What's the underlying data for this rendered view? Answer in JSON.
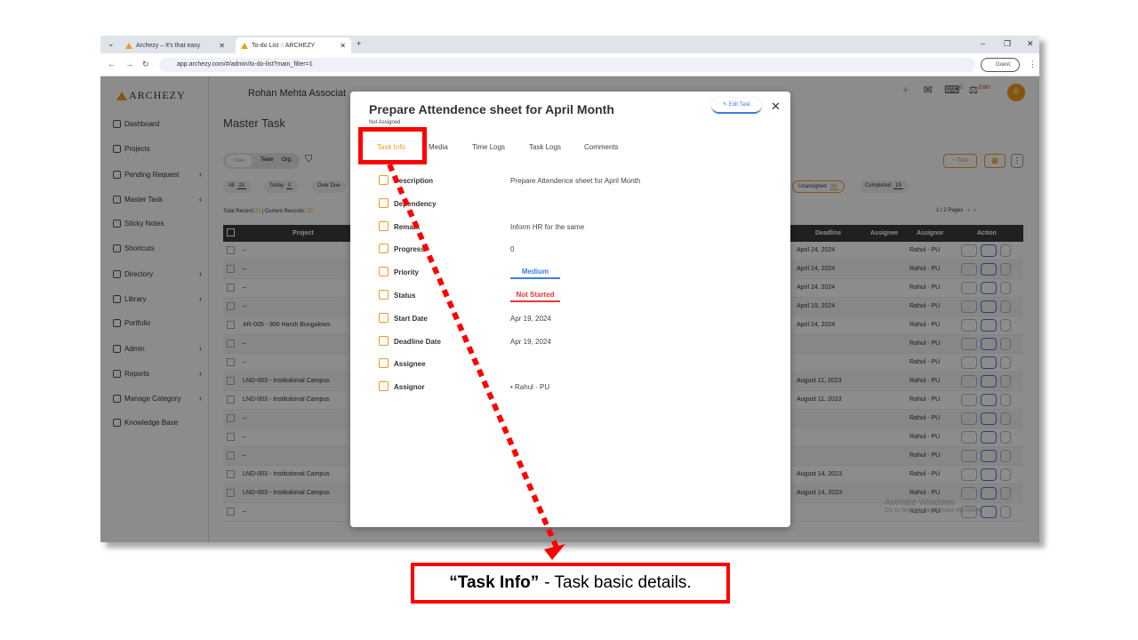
{
  "browser": {
    "tabs": [
      {
        "title": "Archezy – It's that easy",
        "active": false
      },
      {
        "title": "To-do List :: ARCHEZY",
        "active": true
      }
    ],
    "new_tab": "+",
    "url": "app.archezy.com/#/admin/to-do-list?main_filter=1",
    "profile": "Guest",
    "controls": {
      "minimize": "–",
      "restore": "❐",
      "close": "✕"
    }
  },
  "app": {
    "brand": "ARCHEZY",
    "company": "Rohan Mehta Associat",
    "page_title": "Master Task",
    "notif_count": "0",
    "badge_count": "2080",
    "avatar_initial": "R",
    "sidebar": [
      {
        "label": "Dashboard",
        "icon": "home-icon",
        "chevron": ""
      },
      {
        "label": "Projects",
        "icon": "building-icon",
        "chevron": ""
      },
      {
        "label": "Pending Request",
        "icon": "clipboard-icon",
        "chevron": "‹"
      },
      {
        "label": "Master Task",
        "icon": "list-icon",
        "chevron": "‹"
      },
      {
        "label": "Sticky Notes",
        "icon": "note-icon",
        "chevron": ""
      },
      {
        "label": "Shortcuts",
        "icon": "shortcut-icon",
        "chevron": ""
      },
      {
        "label": "Directory",
        "icon": "book-icon",
        "chevron": "‹"
      },
      {
        "label": "Library",
        "icon": "library-icon",
        "chevron": "‹"
      },
      {
        "label": "Portfolio",
        "icon": "folder-icon",
        "chevron": ""
      },
      {
        "label": "Admin",
        "icon": "shield-icon",
        "chevron": "‹"
      },
      {
        "label": "Reports",
        "icon": "report-icon",
        "chevron": "‹"
      },
      {
        "label": "Manage Category",
        "icon": "category-icon",
        "chevron": "‹"
      },
      {
        "label": "Knowledge Base",
        "icon": "bulb-icon",
        "chevron": ""
      }
    ],
    "toggle": {
      "user": "User",
      "team": "Team",
      "org": "Org."
    },
    "filters": [
      {
        "label": "All",
        "count": "21"
      },
      {
        "label": "Today",
        "count": "0"
      },
      {
        "label": "Over Due",
        "count": ""
      }
    ],
    "status_filters": [
      {
        "label": "Unassigned",
        "count": "21"
      },
      {
        "label": "Completed",
        "count": "19"
      }
    ],
    "records_label": "Total Record:",
    "records_total": "23",
    "records_sep": " | Current Records: ",
    "records_current": "20",
    "pagination": "1 / 2 Pages",
    "task_button": "+ Task",
    "columns": {
      "project": "Project",
      "deadline": "Deadline",
      "assignee": "Assignee",
      "assignor": "Assignor",
      "action": "Action"
    },
    "rows": [
      {
        "project": "–",
        "deadline": "April 24, 2024",
        "assignor": "Rahul - PU"
      },
      {
        "project": "–",
        "deadline": "April 24, 2024",
        "assignor": "Rahul - PU"
      },
      {
        "project": "–",
        "deadline": "April 24, 2024",
        "assignor": "Rahul - PU"
      },
      {
        "project": "–",
        "deadline": "April 19, 2024",
        "assignor": "Rahul - PU"
      },
      {
        "project": "AR-005 - 900 Harsh Bungalows",
        "deadline": "April 24, 2024",
        "assignor": "Rahul - PU"
      },
      {
        "project": "–",
        "deadline": "",
        "assignor": "Rahul - PU"
      },
      {
        "project": "–",
        "deadline": "",
        "assignor": "Rahul - PU"
      },
      {
        "project": "LND-003 - Institutional Campus",
        "deadline": "August 11, 2023",
        "assignor": "Rahul - PU"
      },
      {
        "project": "LND-003 - Institutional Campus",
        "deadline": "August 11, 2023",
        "assignor": "Rahul - PU"
      },
      {
        "project": "–",
        "deadline": "",
        "assignor": "Rahul - PU"
      },
      {
        "project": "–",
        "deadline": "",
        "assignor": "Rahul - PU"
      },
      {
        "project": "–",
        "deadline": "",
        "assignor": "Rahul - PU"
      },
      {
        "project": "LND-003 - Institutional Campus",
        "deadline": "August 14, 2023",
        "assignor": "Rahul - PU"
      },
      {
        "project": "LND-003 - Institutional Campus",
        "deadline": "August 14, 2023",
        "assignor": "Rahul - PU"
      },
      {
        "project": "–",
        "deadline": "",
        "assignor": "Rahul - PU"
      }
    ],
    "watermark_title": "Activate Windows",
    "watermark_sub": "Go to Settings to activate Windows."
  },
  "modal": {
    "title": "Prepare Attendence sheet for April Month",
    "subtitle": "Not Assigned",
    "edit_label": "Edit Task",
    "close": "✕",
    "tabs": [
      "Task Info",
      "Media",
      "Time Logs",
      "Task Logs",
      "Comments"
    ],
    "fields": [
      {
        "label": "Description",
        "value": "Prepare Attendence sheet for April Month"
      },
      {
        "label": "Dependency",
        "value": ""
      },
      {
        "label": "Remark",
        "value": "Inform HR for the same"
      },
      {
        "label": "Progress",
        "value": "0"
      },
      {
        "label": "Priority",
        "value": "Medium"
      },
      {
        "label": "Status",
        "value": "Not Started"
      },
      {
        "label": "Start Date",
        "value": "Apr 19, 2024"
      },
      {
        "label": "Deadline Date",
        "value": "Apr 19, 2024"
      },
      {
        "label": "Assignee",
        "value": ""
      },
      {
        "label": "Assignor",
        "value": "Rahul - PU"
      }
    ],
    "priority_color": "#3b7fd9",
    "status_color": "#e53935"
  },
  "annotation": {
    "caption_bold": "“Task Info”",
    "caption_rest": "- Task basic details.",
    "color": "#ff0000"
  }
}
